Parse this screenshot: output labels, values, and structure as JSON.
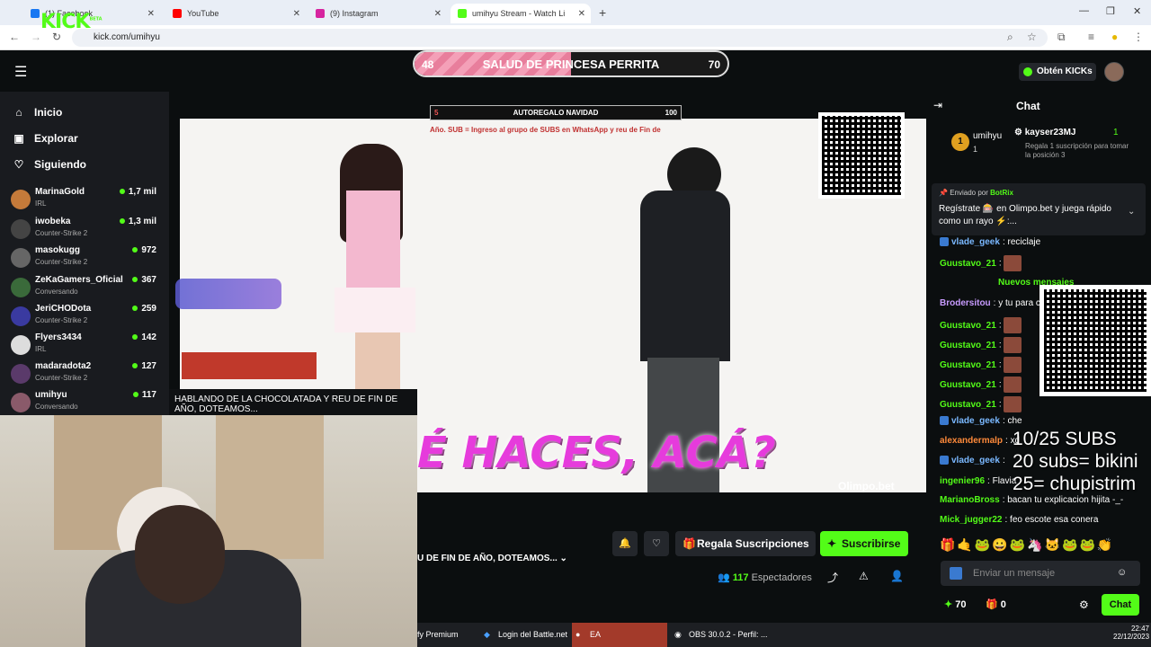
{
  "browser": {
    "tabs": [
      {
        "label": "(1) Facebook",
        "color": "#1877f2"
      },
      {
        "label": "YouTube",
        "color": "#ff0000"
      },
      {
        "label": "(9) Instagram",
        "color": "#d6249f"
      },
      {
        "label": "umihyu Stream - Watch Li",
        "color": "#53fc18"
      }
    ],
    "url": "kick.com/umihyu"
  },
  "kick": {
    "beta": "BETA",
    "obten": "Obtén KICKs"
  },
  "health_bar": {
    "title": "SALUD DE PRINCESA PERRITA",
    "current": "48",
    "max": "70",
    "fill_fraction": 0.5
  },
  "sidebar": {
    "nav": [
      {
        "label": "Inicio",
        "icon": "home-icon"
      },
      {
        "label": "Explorar",
        "icon": "explore-icon"
      },
      {
        "label": "Siguiendo",
        "icon": "heart-icon"
      }
    ],
    "channels": [
      {
        "name": "MarinaGold",
        "category": "IRL",
        "viewers": "1,7 mil",
        "color": "#c47a3a"
      },
      {
        "name": "iwobeka",
        "category": "Counter-Strike 2",
        "viewers": "1,3 mil",
        "color": "#444"
      },
      {
        "name": "masokugg",
        "category": "Counter-Strike 2",
        "viewers": "972",
        "color": "#666"
      },
      {
        "name": "ZeKaGamers_Oficial",
        "category": "Conversando",
        "viewers": "367",
        "color": "#3a6a3a"
      },
      {
        "name": "JeriCHODota",
        "category": "Counter-Strike 2",
        "viewers": "259",
        "color": "#3a3aa0"
      },
      {
        "name": "Flyers3434",
        "category": "IRL",
        "viewers": "142",
        "color": "#ddd"
      },
      {
        "name": "madaradota2",
        "category": "Counter-Strike 2",
        "viewers": "127",
        "color": "#5a3a6a"
      },
      {
        "name": "umihyu",
        "category": "Conversando",
        "viewers": "117",
        "color": "#8a5a6a"
      }
    ],
    "tooltip": "HABLANDO DE LA CHOCOLATADA Y REU DE FIN DE AÑO, DOTEAMOS..."
  },
  "video": {
    "autoregalo_left": "5",
    "autoregalo_title": "AUTOREGALO NAVIDAD",
    "autoregalo_right": "100",
    "ticker": "Año. SUB = Ingreso al grupo de SUBS en WhatsApp y reu de Fin de",
    "caption": "É HACES, ACÁ?",
    "sponsor": "Olimpo.bet"
  },
  "stream": {
    "title_fragment": "U DE FIN DE AÑO, DOTEAMOS...",
    "regala": "Regala Suscripciones",
    "suscribirse": "Suscribirse",
    "viewers_count": "117",
    "viewers_label": "Espectadores"
  },
  "chat": {
    "title": "Chat",
    "top_gifter": {
      "rank": "1",
      "name": "umihyu",
      "count": "1"
    },
    "second": {
      "name": "kayser23MJ",
      "count": "1",
      "note": "Regala 1 suscripción para tomar la posición 3"
    },
    "pinned": {
      "by_label": "Enviado por",
      "by_name": "BotRix",
      "text": "Regístrate 🎰 en Olimpo.bet y juega rápido como un rayo ⚡:..."
    },
    "new_messages": "Nuevos mensajes",
    "messages": [
      {
        "user": "vlade_geek",
        "text": "reciclaje",
        "color": "#7ab8ff"
      },
      {
        "user": "Guustavo_21",
        "text": "",
        "color": "#53fc18",
        "emote": true
      },
      {
        "user": "Brodersitou",
        "text": "y tu para cu",
        "color": "#c89bff"
      },
      {
        "user": "Guustavo_21",
        "text": "",
        "color": "#53fc18",
        "emote": true
      },
      {
        "user": "Guustavo_21",
        "text": "",
        "color": "#53fc18",
        "emote": true
      },
      {
        "user": "Guustavo_21",
        "text": "",
        "color": "#53fc18",
        "emote": true
      },
      {
        "user": "Guustavo_21",
        "text": "",
        "color": "#53fc18",
        "emote": true
      },
      {
        "user": "Guustavo_21",
        "text": "",
        "color": "#53fc18",
        "emote": true
      },
      {
        "user": "vlade_geek",
        "text": "che",
        "color": "#7ab8ff"
      },
      {
        "user": "alexandermalp",
        "text": "xd",
        "color": "#ff8a3a"
      },
      {
        "user": "vlade_geek",
        "text": "",
        "color": "#7ab8ff"
      },
      {
        "user": "ingenier96",
        "text": "Flavia",
        "color": "#53fc18"
      },
      {
        "user": "MarianoBross",
        "text": "bacan tu explicacion hijita -_-",
        "color": "#53fc18"
      },
      {
        "user": "Mick_jugger22",
        "text": "feo escote esa conera",
        "color": "#53fc18"
      }
    ],
    "subs_overlay": [
      "10/25 SUBS",
      "20 subs= bikini",
      "25= chupistrim"
    ],
    "input_placeholder": "Enviar un mensaje",
    "kicks": "70",
    "gifts": "0",
    "send_label": "Chat"
  },
  "taskbar": {
    "items": [
      "fy Premium",
      "Login del Battle.net",
      "EA",
      "OBS 30.0.2 - Perfil: ..."
    ],
    "time": "22:47",
    "date": "22/12/2023"
  }
}
